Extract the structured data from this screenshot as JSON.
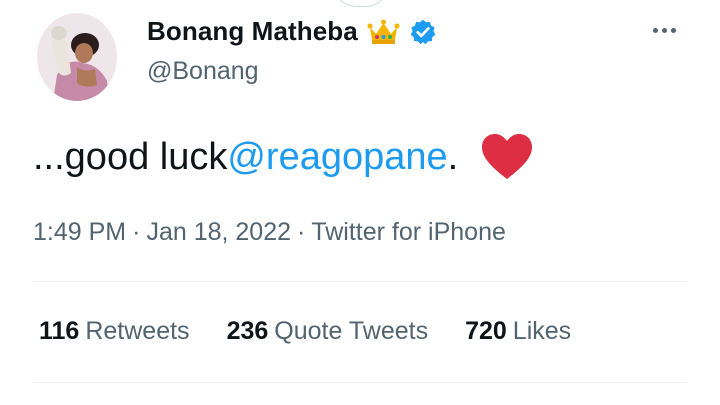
{
  "tweet": {
    "author": {
      "display_name": "Bonang Matheba",
      "handle": "@Bonang",
      "emoji": "crown",
      "verified_icon": "verified-badge-icon",
      "avatar": "profile-photo"
    },
    "text": {
      "prefix": "...good luck ",
      "mention": "@reagopane",
      "suffix": ".",
      "emoji": "red-heart"
    },
    "meta": {
      "time": "1:49 PM",
      "date": "Jan 18, 2022",
      "source": "Twitter for iPhone",
      "separator": "·"
    },
    "stats": {
      "retweets": {
        "count": "116",
        "label": "Retweets"
      },
      "quotes": {
        "count": "236",
        "label": "Quote Tweets"
      },
      "likes": {
        "count": "720",
        "label": "Likes"
      }
    }
  },
  "colors": {
    "text": "#0f1419",
    "secondary": "#536471",
    "link": "#1d9bf0",
    "heart": "#dd2e44",
    "divider": "#eff3f4"
  }
}
